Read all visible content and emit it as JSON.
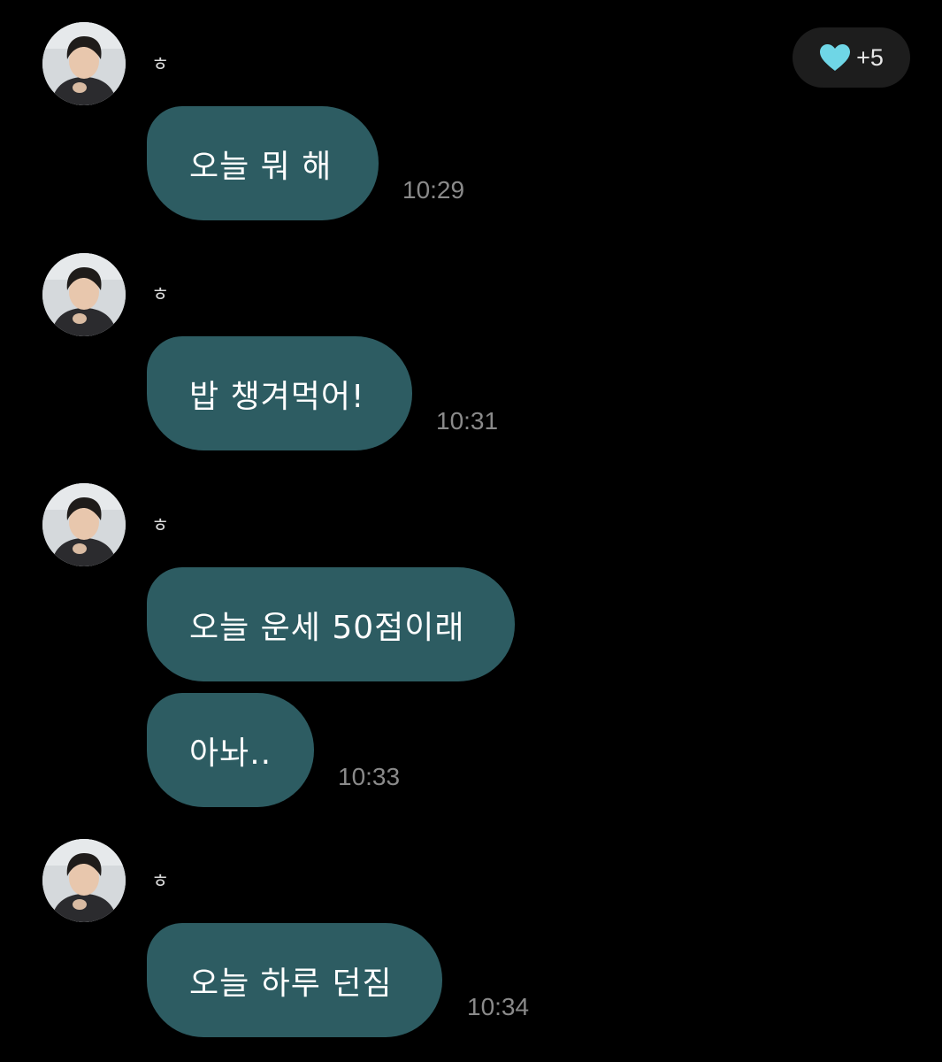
{
  "reaction": {
    "icon": "heart-icon",
    "color": "#6fd6e6",
    "count": "+5"
  },
  "messages": [
    {
      "sender": "ㅎ",
      "text": "오늘 뭐 해",
      "time": "10:29"
    },
    {
      "sender": "ㅎ",
      "text": "밥 챙겨먹어!",
      "time": "10:31"
    },
    {
      "sender": "ㅎ",
      "text": "오늘 운세 50점이래",
      "time": ""
    },
    {
      "sender": "",
      "text": "아놔..",
      "time": "10:33"
    },
    {
      "sender": "ㅎ",
      "text": "오늘 하루 던짐",
      "time": "10:34"
    }
  ],
  "colors": {
    "background": "#000000",
    "bubble": "#2d5c62",
    "timestamp": "#8a8a8a"
  }
}
